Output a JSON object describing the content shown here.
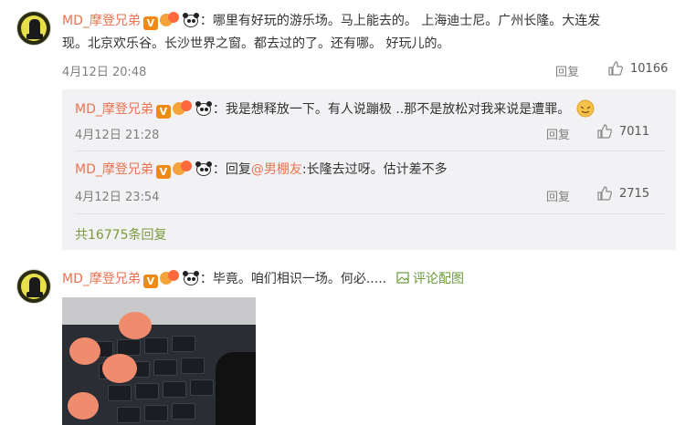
{
  "comment1": {
    "username": "MD_摩登兄弟",
    "verified_badge": "V",
    "text": "：哪里有好玩的游乐场。马上能去的。 上海迪士尼。广州长隆。大连发",
    "text_line2": "现。北京欢乐谷。长沙世界之窗。都去过的了。还有哪。 好玩儿的。",
    "time": "4月12日 20:48",
    "reply_label": "回复",
    "likes": "10166"
  },
  "replies": [
    {
      "username": "MD_摩登兄弟",
      "verified_badge": "V",
      "text": "：我是想释放一下。有人说蹦极 ..那不是放松对我来说是遭罪。",
      "time": "4月12日 21:28",
      "reply_label": "回复",
      "likes": "7011"
    },
    {
      "username": "MD_摩登兄弟",
      "verified_badge": "V",
      "text_prefix": "：回复",
      "mention": "@男棚友",
      "text_suffix": ":长隆去过呀。估计差不多",
      "time": "4月12日 23:54",
      "reply_label": "回复",
      "likes": "2715"
    }
  ],
  "more_replies": "共16775条回复",
  "comment2": {
    "username": "MD_摩登兄弟",
    "verified_badge": "V",
    "text": "：毕竟。咱们相识一场。何必.....",
    "see_image": "评论配图"
  },
  "icons": {
    "thumb": "thumbs-up-icon",
    "image": "image-icon"
  },
  "colors": {
    "username": "#eb7350",
    "link_green": "#7a9a3c",
    "reply_bg": "#f2f2f5"
  }
}
